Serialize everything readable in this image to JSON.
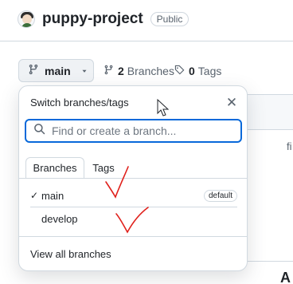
{
  "repo": {
    "name": "puppy-project",
    "visibility": "Public"
  },
  "branch_selector": {
    "current_branch": "main"
  },
  "meta": {
    "branches_count": "2",
    "branches_label": "Branches",
    "tags_count": "0",
    "tags_label": "Tags"
  },
  "background": {
    "fragment_fi": "fi",
    "fragment_a": "A"
  },
  "dropdown": {
    "title": "Switch branches/tags",
    "search_placeholder": "Find or create a branch...",
    "tabs": [
      {
        "label": "Branches",
        "active": true
      },
      {
        "label": "Tags",
        "active": false
      }
    ],
    "branches": [
      {
        "name": "main",
        "selected": true,
        "badge": "default"
      },
      {
        "name": "develop",
        "selected": false,
        "badge": ""
      }
    ],
    "view_all_label": "View all branches"
  },
  "colors": {
    "accent": "#0969da",
    "annotation": "#e0201b"
  }
}
